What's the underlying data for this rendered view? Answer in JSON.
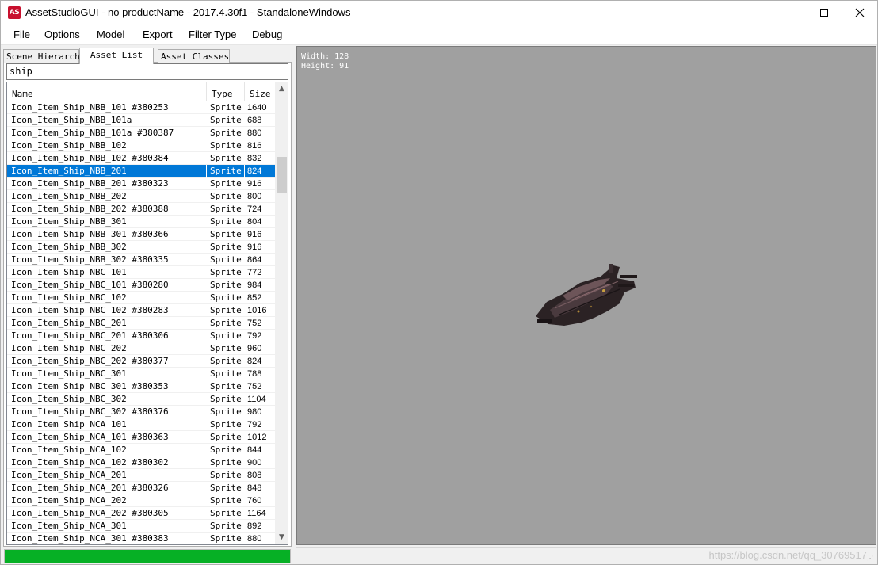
{
  "window": {
    "title": "AssetStudioGUI - no productName - 2017.4.30f1 - StandaloneWindows",
    "icon_label": "AS"
  },
  "menu": [
    "File",
    "Options",
    "Model",
    "Export",
    "Filter Type",
    "Debug"
  ],
  "tabs": {
    "scene": "Scene Hierarchy",
    "asset": "Asset List",
    "classes": "Asset Classes"
  },
  "search": {
    "value": "ship"
  },
  "list": {
    "headers": {
      "name": "Name",
      "type": "Type",
      "size": "Size"
    },
    "selected_index": 5,
    "rows": [
      {
        "name": "Icon_Item_Ship_NBB_101 #380253",
        "type": "Sprite",
        "size": "1640"
      },
      {
        "name": "Icon_Item_Ship_NBB_101a",
        "type": "Sprite",
        "size": "688"
      },
      {
        "name": "Icon_Item_Ship_NBB_101a #380387",
        "type": "Sprite",
        "size": "880"
      },
      {
        "name": "Icon_Item_Ship_NBB_102",
        "type": "Sprite",
        "size": "816"
      },
      {
        "name": "Icon_Item_Ship_NBB_102 #380384",
        "type": "Sprite",
        "size": "832"
      },
      {
        "name": "Icon_Item_Ship_NBB_201",
        "type": "Sprite",
        "size": "824"
      },
      {
        "name": "Icon_Item_Ship_NBB_201 #380323",
        "type": "Sprite",
        "size": "916"
      },
      {
        "name": "Icon_Item_Ship_NBB_202",
        "type": "Sprite",
        "size": "800"
      },
      {
        "name": "Icon_Item_Ship_NBB_202 #380388",
        "type": "Sprite",
        "size": "724"
      },
      {
        "name": "Icon_Item_Ship_NBB_301",
        "type": "Sprite",
        "size": "804"
      },
      {
        "name": "Icon_Item_Ship_NBB_301 #380366",
        "type": "Sprite",
        "size": "916"
      },
      {
        "name": "Icon_Item_Ship_NBB_302",
        "type": "Sprite",
        "size": "916"
      },
      {
        "name": "Icon_Item_Ship_NBB_302 #380335",
        "type": "Sprite",
        "size": "864"
      },
      {
        "name": "Icon_Item_Ship_NBC_101",
        "type": "Sprite",
        "size": "772"
      },
      {
        "name": "Icon_Item_Ship_NBC_101 #380280",
        "type": "Sprite",
        "size": "984"
      },
      {
        "name": "Icon_Item_Ship_NBC_102",
        "type": "Sprite",
        "size": "852"
      },
      {
        "name": "Icon_Item_Ship_NBC_102 #380283",
        "type": "Sprite",
        "size": "1016"
      },
      {
        "name": "Icon_Item_Ship_NBC_201",
        "type": "Sprite",
        "size": "752"
      },
      {
        "name": "Icon_Item_Ship_NBC_201 #380306",
        "type": "Sprite",
        "size": "792"
      },
      {
        "name": "Icon_Item_Ship_NBC_202",
        "type": "Sprite",
        "size": "960"
      },
      {
        "name": "Icon_Item_Ship_NBC_202 #380377",
        "type": "Sprite",
        "size": "824"
      },
      {
        "name": "Icon_Item_Ship_NBC_301",
        "type": "Sprite",
        "size": "788"
      },
      {
        "name": "Icon_Item_Ship_NBC_301 #380353",
        "type": "Sprite",
        "size": "752"
      },
      {
        "name": "Icon_Item_Ship_NBC_302",
        "type": "Sprite",
        "size": "1104"
      },
      {
        "name": "Icon_Item_Ship_NBC_302 #380376",
        "type": "Sprite",
        "size": "980"
      },
      {
        "name": "Icon_Item_Ship_NCA_101",
        "type": "Sprite",
        "size": "792"
      },
      {
        "name": "Icon_Item_Ship_NCA_101 #380363",
        "type": "Sprite",
        "size": "1012"
      },
      {
        "name": "Icon_Item_Ship_NCA_102",
        "type": "Sprite",
        "size": "844"
      },
      {
        "name": "Icon_Item_Ship_NCA_102 #380302",
        "type": "Sprite",
        "size": "900"
      },
      {
        "name": "Icon_Item_Ship_NCA_201",
        "type": "Sprite",
        "size": "808"
      },
      {
        "name": "Icon_Item_Ship_NCA_201 #380326",
        "type": "Sprite",
        "size": "848"
      },
      {
        "name": "Icon_Item_Ship_NCA_202",
        "type": "Sprite",
        "size": "760"
      },
      {
        "name": "Icon_Item_Ship_NCA_202 #380305",
        "type": "Sprite",
        "size": "1164"
      },
      {
        "name": "Icon_Item_Ship_NCA_301",
        "type": "Sprite",
        "size": "892"
      },
      {
        "name": "Icon_Item_Ship_NCA_301 #380383",
        "type": "Sprite",
        "size": "880"
      }
    ]
  },
  "progress": {
    "fraction": 1.0,
    "color": "#06b025"
  },
  "preview": {
    "width_text": "Width: 128",
    "height_text": "Height: 91",
    "background": "#a0a0a0"
  },
  "status": {
    "watermark": "https://blog.csdn.net/qq_30769517"
  },
  "colors": {
    "selection": "#0078d7",
    "app_icon": "#c8102e"
  }
}
